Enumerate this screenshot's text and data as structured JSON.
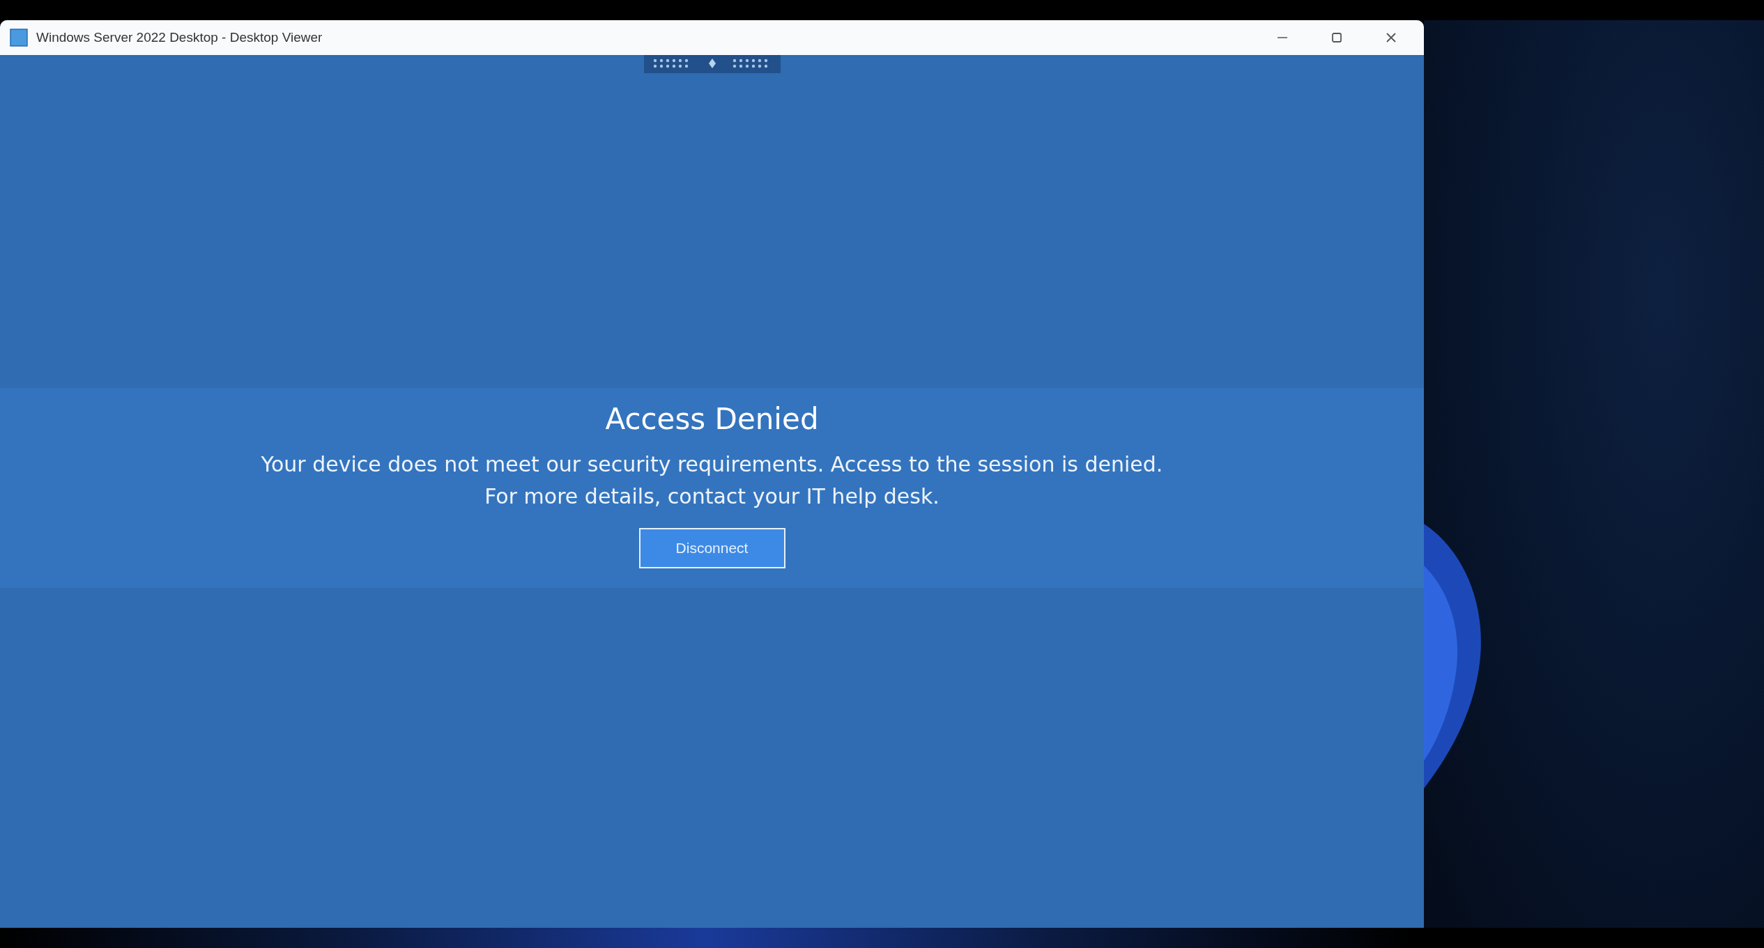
{
  "window": {
    "title": "Windows Server 2022 Desktop - Desktop Viewer"
  },
  "dialog": {
    "title": "Access Denied",
    "message_lines": [
      "Your device does not meet our security requirements. Access to the session is denied.",
      "For more details, contact your IT help desk."
    ],
    "button": {
      "label": "Disconnect"
    }
  }
}
